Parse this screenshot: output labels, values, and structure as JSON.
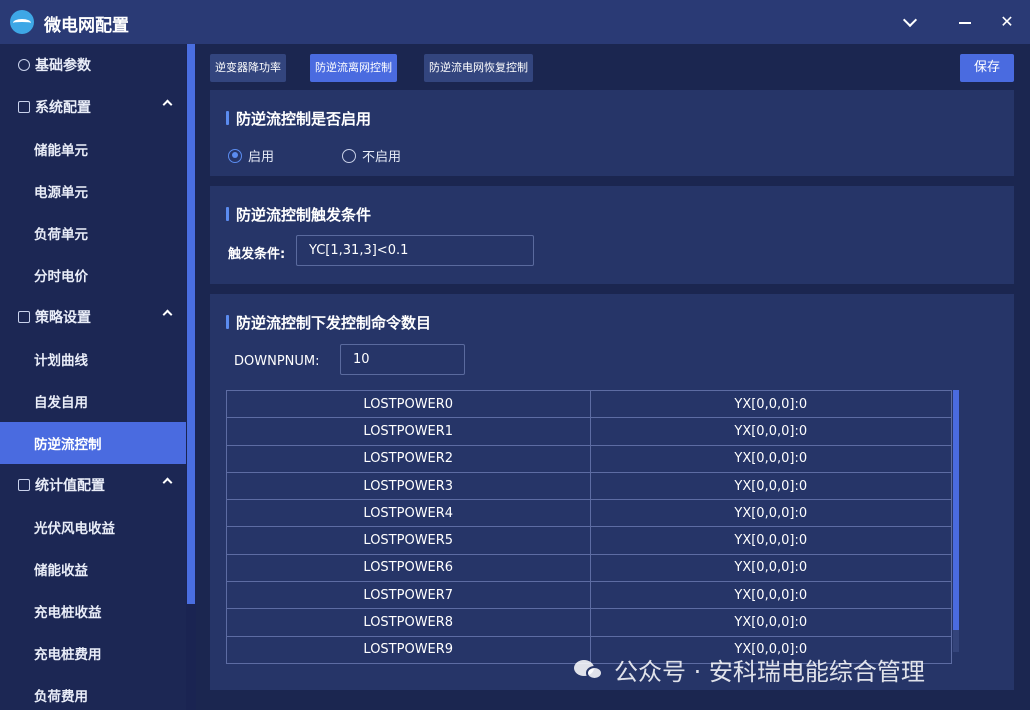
{
  "window": {
    "title": "微电网配置"
  },
  "sidebar": {
    "groups": [
      {
        "label": "基础参数"
      },
      {
        "label": "系统配置",
        "items": [
          "储能单元",
          "电源单元",
          "负荷单元",
          "分时电价"
        ]
      },
      {
        "label": "策略设置",
        "items": [
          "计划曲线",
          "自发自用",
          "防逆流控制"
        ]
      },
      {
        "label": "统计值配置",
        "items": [
          "光伏风电收益",
          "储能收益",
          "充电桩收益",
          "充电桩费用",
          "负荷费用"
        ]
      }
    ],
    "active_item": "防逆流控制"
  },
  "tabs": [
    "逆变器降功率",
    "防逆流离网控制",
    "防逆流电网恢复控制"
  ],
  "active_tab": "防逆流离网控制",
  "save_label": "保存",
  "enable_section": {
    "title": "防逆流控制是否启用",
    "options": [
      "启用",
      "不启用"
    ],
    "selected": "启用"
  },
  "trigger_section": {
    "title": "防逆流控制触发条件",
    "label": "触发条件:",
    "value": "YC[1,31,3]<0.1"
  },
  "command_section": {
    "title": "防逆流控制下发控制命令数目",
    "downpnum_label": "DOWNPNUM:",
    "downpnum_value": "10",
    "rows": [
      [
        "LOSTPOWER0",
        "YX[0,0,0]:0"
      ],
      [
        "LOSTPOWER1",
        "YX[0,0,0]:0"
      ],
      [
        "LOSTPOWER2",
        "YX[0,0,0]:0"
      ],
      [
        "LOSTPOWER3",
        "YX[0,0,0]:0"
      ],
      [
        "LOSTPOWER4",
        "YX[0,0,0]:0"
      ],
      [
        "LOSTPOWER5",
        "YX[0,0,0]:0"
      ],
      [
        "LOSTPOWER6",
        "YX[0,0,0]:0"
      ],
      [
        "LOSTPOWER7",
        "YX[0,0,0]:0"
      ],
      [
        "LOSTPOWER8",
        "YX[0,0,0]:0"
      ],
      [
        "LOSTPOWER9",
        "YX[0,0,0]:0"
      ]
    ]
  },
  "watermark": "公众号 · 安科瑞电能综合管理",
  "colors": {
    "accent": "#4a6be0",
    "titlebar": "#2a3a75",
    "panel": "#263568",
    "background": "#1b2650"
  }
}
